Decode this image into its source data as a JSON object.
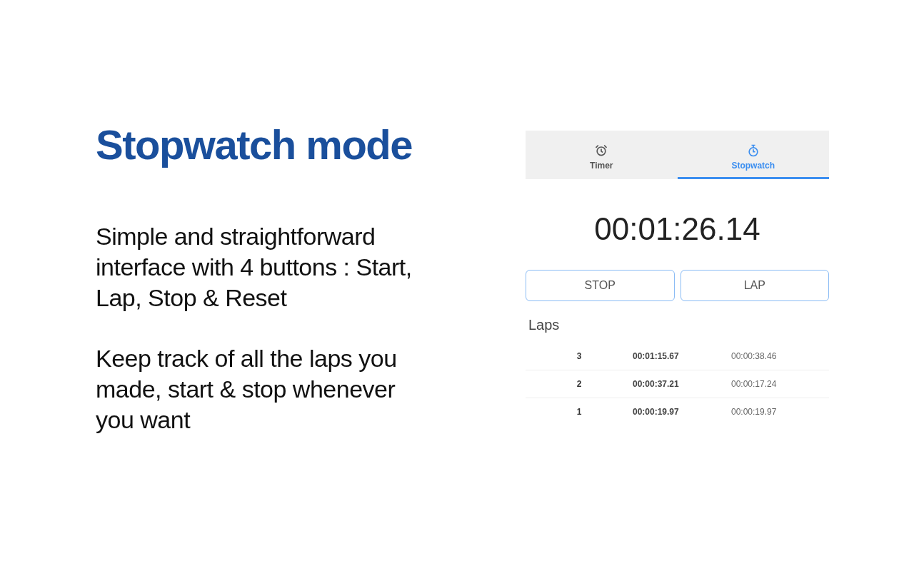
{
  "heading": "Stopwatch mode",
  "paragraphs": [
    "Simple and straightforward interface with 4 buttons : Start, Lap, Stop & Reset",
    "Keep track of all the laps you made, start & stop whenever you want"
  ],
  "tabs": [
    {
      "label": "Timer",
      "kind": "alarm",
      "selected": false
    },
    {
      "label": "Stopwatch",
      "kind": "stopwatch",
      "selected": true
    }
  ],
  "display": "00:01:26.14",
  "buttons": [
    "STOP",
    "LAP"
  ],
  "laps_title": "Laps",
  "laps": [
    {
      "lap": "3",
      "column_2": "00:01:15.67",
      "column_3": "00:00:38.46"
    },
    {
      "lap": "2",
      "column_2": "00:00:37.21",
      "column_3": "00:00:17.24"
    },
    {
      "lap": "1",
      "column_2": "00:00:19.97",
      "column_3": "00:00:19.97"
    }
  ]
}
